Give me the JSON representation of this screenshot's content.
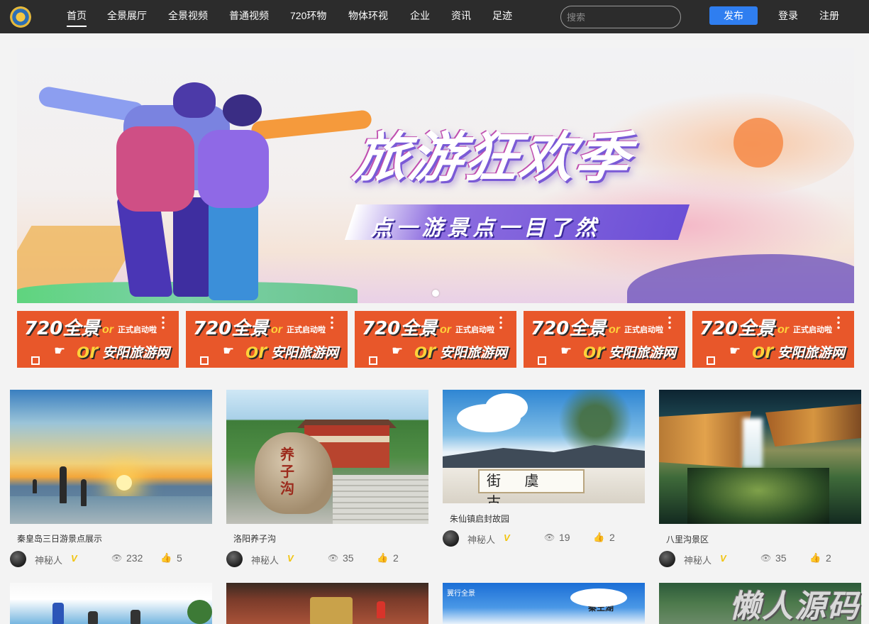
{
  "nav": {
    "items": [
      "首页",
      "全景展厅",
      "全景视频",
      "普通视频",
      "720环物",
      "物体环视",
      "企业",
      "资讯",
      "足迹"
    ],
    "active": "首页",
    "search_placeholder": "搜索",
    "publish_label": "发布",
    "login_label": "登录",
    "register_label": "注册"
  },
  "banner": {
    "title": "旅游狂欢季",
    "subtitle": "点一游景点一目了然"
  },
  "ads": [
    {
      "line1": "720全景",
      "or": "or",
      "line2": "正式启动啦",
      "or_big": "or",
      "line3": "安阳旅游网"
    },
    {
      "line1": "720全景",
      "or": "or",
      "line2": "正式启动啦",
      "or_big": "or",
      "line3": "安阳旅游网"
    },
    {
      "line1": "720全景",
      "or": "or",
      "line2": "正式启动啦",
      "or_big": "or",
      "line3": "安阳旅游网"
    },
    {
      "line1": "720全景",
      "or": "or",
      "line2": "正式启动啦",
      "or_big": "or",
      "line3": "安阳旅游网"
    },
    {
      "line1": "720全景",
      "or": "or",
      "line2": "正式启动啦",
      "or_big": "or",
      "line3": "安阳旅游网"
    }
  ],
  "cards": [
    {
      "title": "秦皇岛三日游景点展示",
      "user": "神秘人",
      "views": "232",
      "likes": "5"
    },
    {
      "title": "洛阳养子沟",
      "user": "神秘人",
      "views": "35",
      "likes": "2"
    },
    {
      "title": "朱仙镇启封故园",
      "user": "神秘人",
      "views": "19",
      "likes": "2",
      "plaque": "街 虞 古"
    },
    {
      "title": "八里沟景区",
      "user": "神秘人",
      "views": "35",
      "likes": "2"
    }
  ],
  "stone_text": "养子沟",
  "bottom_row": {
    "third_label": "秦王湖",
    "third_logo": "翼行全景"
  },
  "watermark": "懒人源码"
}
